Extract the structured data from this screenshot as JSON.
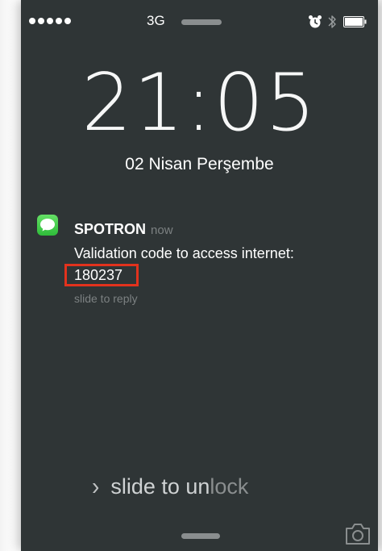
{
  "status_bar": {
    "signal_dots": 5,
    "network": "3G",
    "icons": [
      "alarm-icon",
      "bluetooth-icon",
      "battery-icon"
    ]
  },
  "lock_screen": {
    "time": "21:05",
    "date": "02 Nisan Perşembe"
  },
  "notification": {
    "app_icon": "messages-icon",
    "sender": "SPOTRON",
    "time_ago": "now",
    "message": "Validation code to access internet:",
    "code": "180237",
    "reply_hint": "slide to reply",
    "highlight_color": "#e2321d"
  },
  "unlock": {
    "text_bright": "slide to un",
    "text_faded": "lock"
  },
  "icons": {
    "camera": "camera-icon",
    "chevron": "chevron-right-icon"
  },
  "colors": {
    "background": "#2f3536",
    "messages_green": "#3fc94a"
  }
}
